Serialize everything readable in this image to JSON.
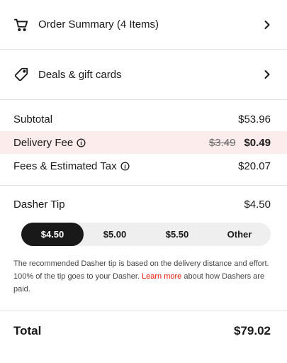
{
  "order_summary": {
    "label": "Order Summary (4 Items)",
    "icon": "cart-icon"
  },
  "deals": {
    "label": "Deals & gift cards",
    "icon": "tag-icon"
  },
  "subtotal": {
    "label": "Subtotal",
    "value": "$53.96"
  },
  "delivery_fee": {
    "label": "Delivery Fee",
    "original": "$3.49",
    "value": "$0.49"
  },
  "fees_tax": {
    "label": "Fees & Estimated Tax",
    "value": "$20.07"
  },
  "tip": {
    "label": "Dasher Tip",
    "value": "$4.50",
    "options": [
      "$4.50",
      "$5.00",
      "$5.50",
      "Other"
    ],
    "selected": "$4.50",
    "disclaimer_before": "The recommended Dasher tip is based on the delivery distance and effort. 100% of the tip goes to your Dasher. ",
    "learn_more": "Learn more",
    "disclaimer_after": " about how Dashers are paid."
  },
  "total": {
    "label": "Total",
    "value": "$79.02"
  },
  "colors": {
    "highlight_bg": "#fdecec",
    "link": "#eb1700",
    "selected_bg": "#191919"
  }
}
